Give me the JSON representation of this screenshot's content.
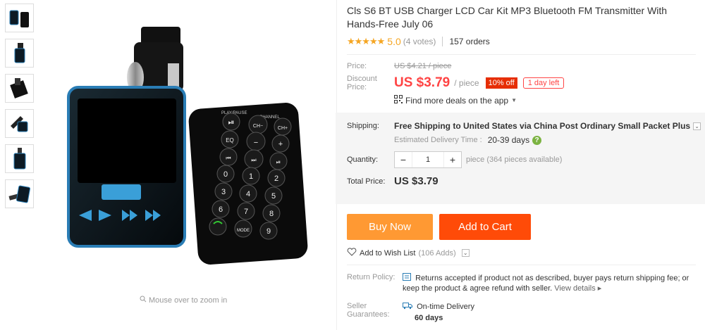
{
  "gallery": {
    "thumbnails": [
      "thumb-1",
      "thumb-2",
      "thumb-3",
      "thumb-4",
      "thumb-5",
      "thumb-6"
    ],
    "zoom_hint": "Mouse over to zoom in"
  },
  "remote": {
    "labels": {
      "play_pause": "PLAY/PAUSE",
      "channel": "CHANNEL",
      "ch_minus": "CH−",
      "ch": "CH",
      "ch_plus": "CH+",
      "eq": "EQ",
      "mode": "MODE"
    },
    "digits": [
      "0",
      "1",
      "2",
      "3",
      "4",
      "5",
      "6",
      "7",
      "8",
      "9"
    ]
  },
  "product": {
    "title": "Cls S6 BT USB Charger LCD Car Kit MP3 Bluetooth FM Transmitter With Hands-Free July 06",
    "rating_stars": "★★★★★",
    "rating_value": "5.0",
    "votes": "(4 votes)",
    "orders": "157 orders"
  },
  "price": {
    "price_label": "Price:",
    "original": "US $4.21 / piece",
    "discount_label": "Discount Price:",
    "current": "US $3.79",
    "per_piece": "/ piece",
    "off_badge": "10% off",
    "days_left": "1 day left",
    "app_deals": "Find more deals on the app"
  },
  "shipping": {
    "label": "Shipping:",
    "text": "Free Shipping to United States via China Post Ordinary Small Packet Plus",
    "eta_label": "Estimated Delivery Time :",
    "eta_days": "20-39 days",
    "eta_help": "?"
  },
  "quantity": {
    "label": "Quantity:",
    "minus": "−",
    "value": "1",
    "plus": "+",
    "available": "piece (364 pieces available)"
  },
  "total": {
    "label": "Total Price:",
    "value": "US $3.79"
  },
  "actions": {
    "buy_now": "Buy Now",
    "add_to_cart": "Add to Cart",
    "wish_list": "Add to Wish List",
    "wish_count": "(106 Adds)"
  },
  "policy": {
    "return_label": "Return Policy:",
    "return_text": "Returns accepted if product not as described, buyer pays return shipping fee; or keep the product & agree refund with seller.",
    "view_details": "View details",
    "guarantee_label": "Seller Guarantees:",
    "guarantee_text": "On-time Delivery",
    "guarantee_days": "60 days"
  },
  "colors": {
    "price_red": "#ff4444",
    "buy_now": "#ff9933",
    "add_to_cart": "#ff4b08",
    "star": "#f5a623"
  }
}
